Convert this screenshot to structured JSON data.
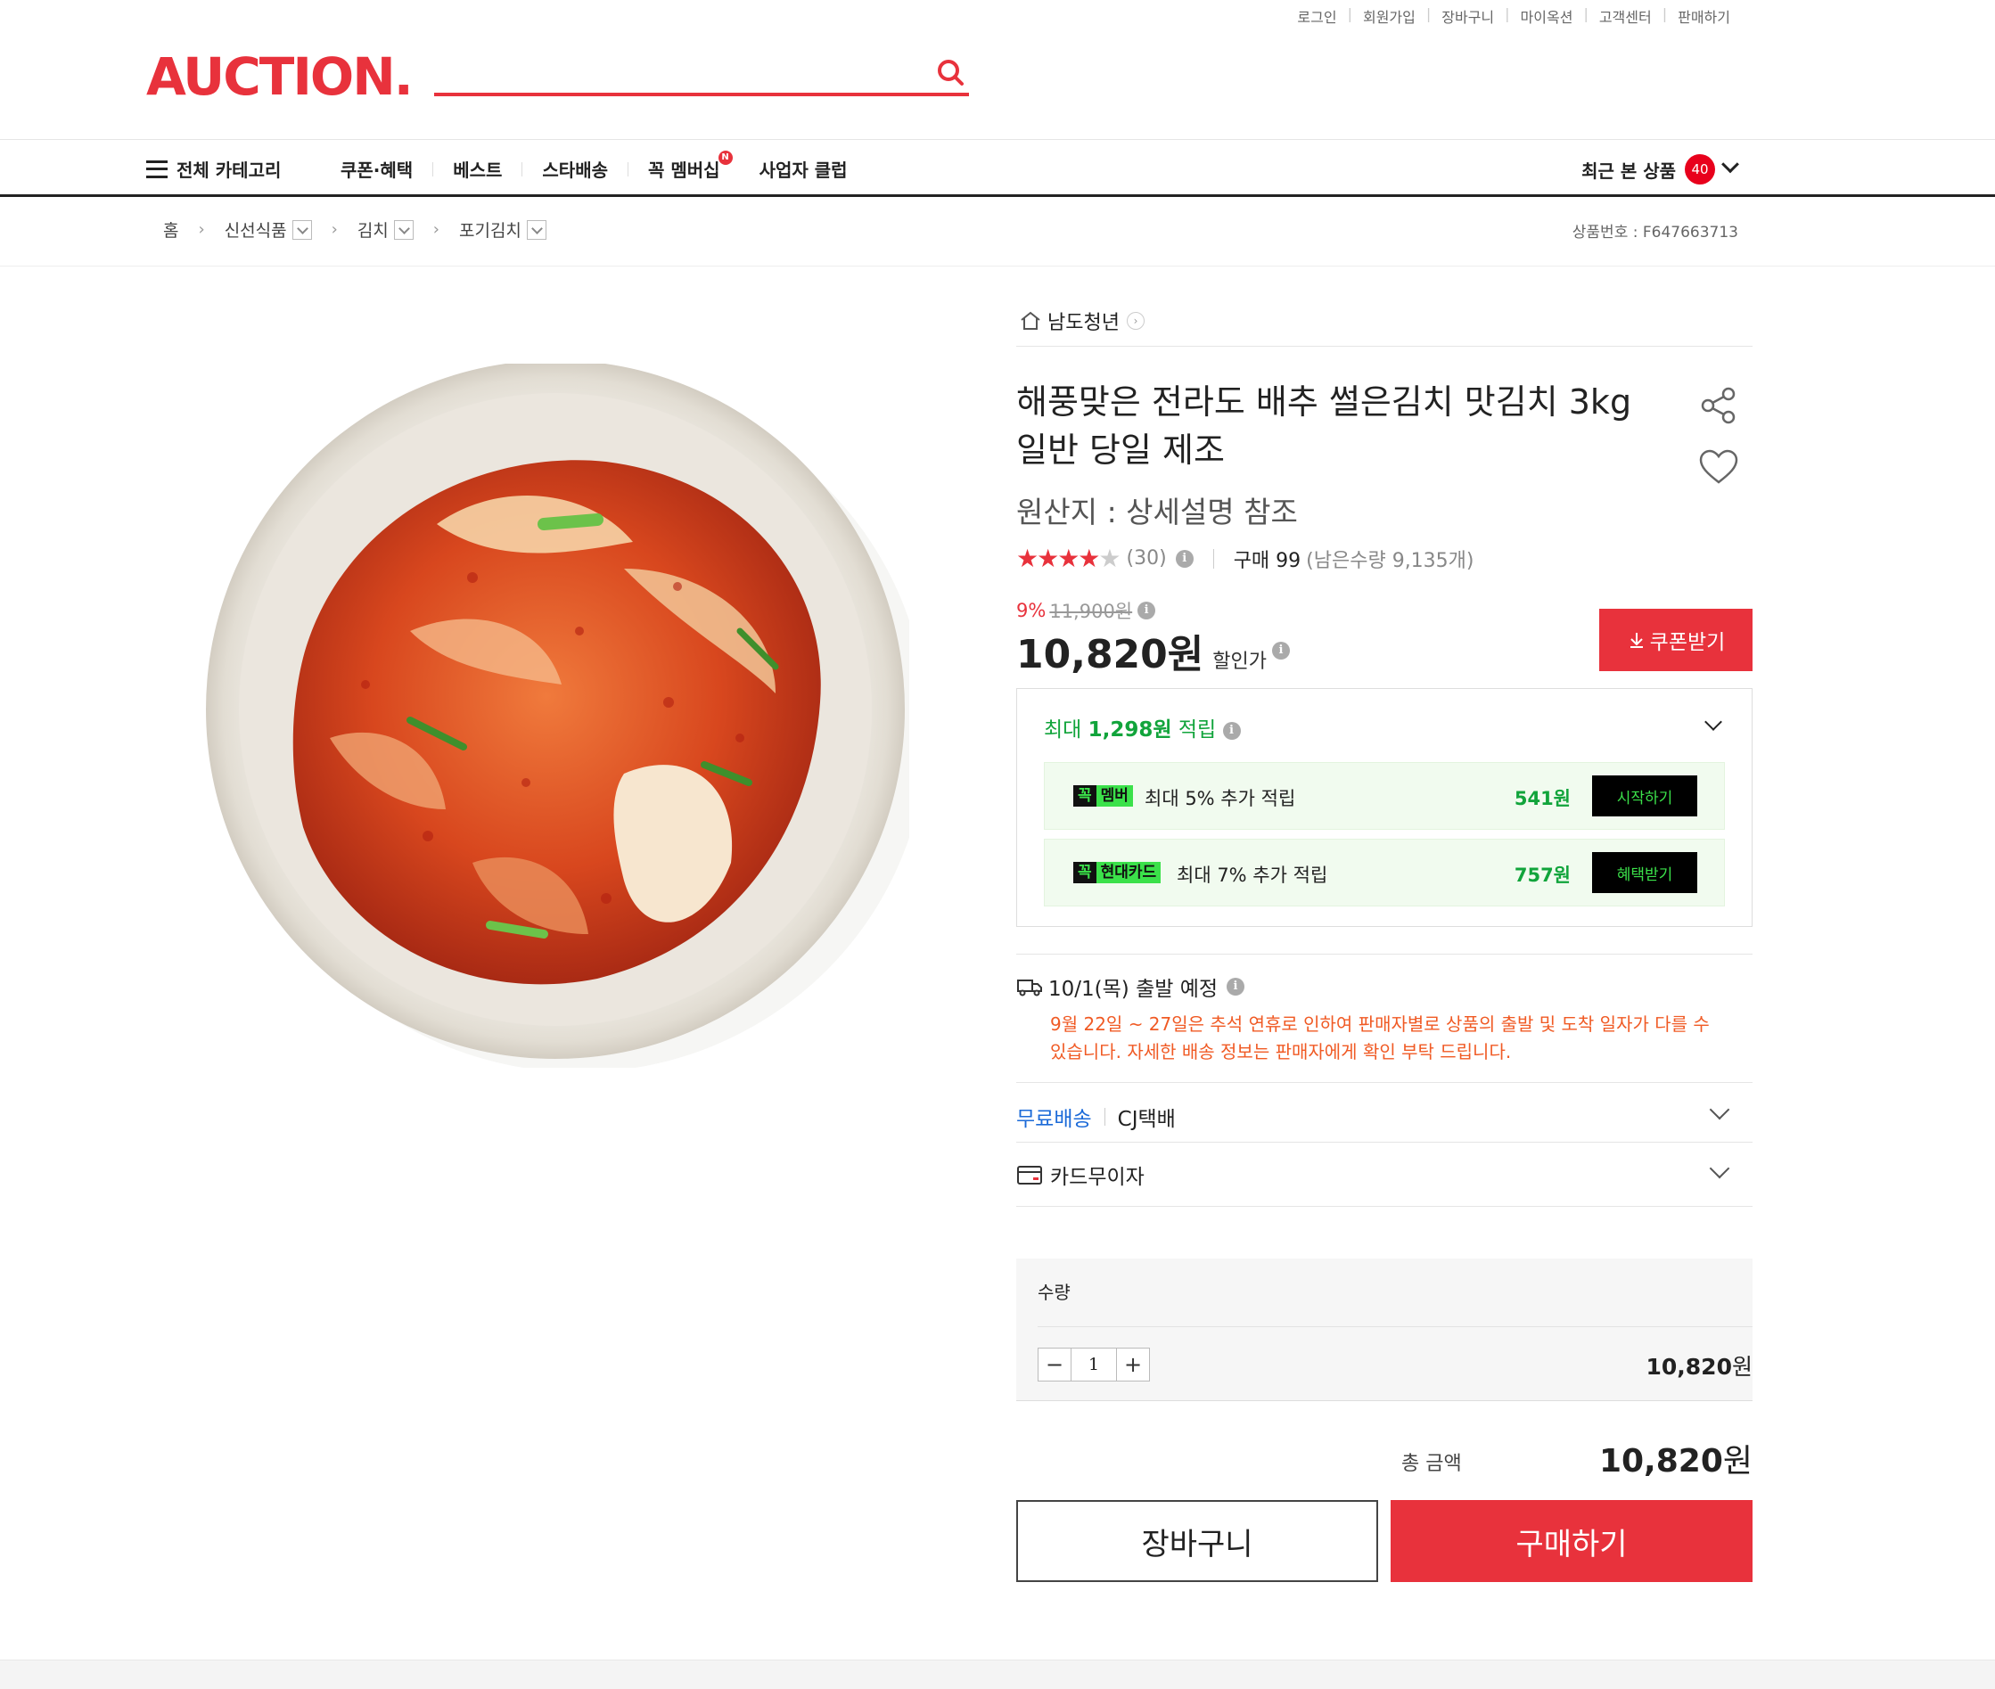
{
  "util_links": [
    "로그인",
    "회원가입",
    "장바구니",
    "마이옥션",
    "고객센터",
    "판매하기"
  ],
  "logo": "AUCTION.",
  "search": {
    "placeholder": ""
  },
  "nav": {
    "category": "전체 카테고리",
    "items": [
      "쿠폰·혜택",
      "베스트",
      "스타배송",
      "꼭 멤버십",
      "사업자 클럽"
    ],
    "new_badge": "N",
    "recent_label": "최근 본 상품",
    "recent_count": "40"
  },
  "breadcrumb": {
    "home": "홈",
    "items": [
      "신선식품",
      "김치",
      "포기김치"
    ]
  },
  "product_no": "상품번호 : F647663713",
  "seller": "남도청년",
  "title_line1": "해풍맞은 전라도 배추 썰은김치 맛김치 3kg",
  "title_line2": "일반 당일 제조",
  "origin": "원산지 : 상세설명 참조",
  "rating": {
    "stars": 4.5,
    "review_count": "(30)",
    "purchase": "구매 99",
    "remain": "(남은수량 9,135개)"
  },
  "price": {
    "discount_pct": "9%",
    "original": "11,900원",
    "sale": "10,820원",
    "sale_label": "할인가"
  },
  "coupon_button": "쿠폰받기",
  "reward": {
    "head_prefix": "최대 ",
    "head_amount": "1,298원",
    "head_suffix": " 적립",
    "rows": [
      {
        "badge_k": "꼭",
        "badge_n": "멤버",
        "text": "최대 5% 추가 적립",
        "amount": "541원",
        "button": "시작하기"
      },
      {
        "badge_k": "꼭",
        "badge_n": "현대카드",
        "text": "최대 7% 추가 적립",
        "amount": "757원",
        "button": "혜택받기"
      }
    ]
  },
  "shipping": {
    "date": "10/1(목) 출발 예정",
    "notice": "9월 22일 ~ 27일은 추석 연휴로 인하여 판매자별로 상품의 출발 및 도착 일자가 다를 수 있습니다. 자세한 배송 정보는 판매자에게 확인 부탁 드립니다.",
    "free": "무료배송",
    "carrier": "CJ택배"
  },
  "card_label": "카드무이자",
  "quantity": {
    "label": "수량",
    "value": "1",
    "sum_number": "10,820",
    "sum_unit": "원"
  },
  "total": {
    "label": "총 금액",
    "number": "10,820",
    "unit": "원"
  },
  "buttons": {
    "cart": "장바구니",
    "buy": "구매하기"
  },
  "colors": {
    "brand": "#e8323c",
    "green": "#11a43b",
    "notice": "#f05a24",
    "link_blue": "#1b6ad8"
  }
}
